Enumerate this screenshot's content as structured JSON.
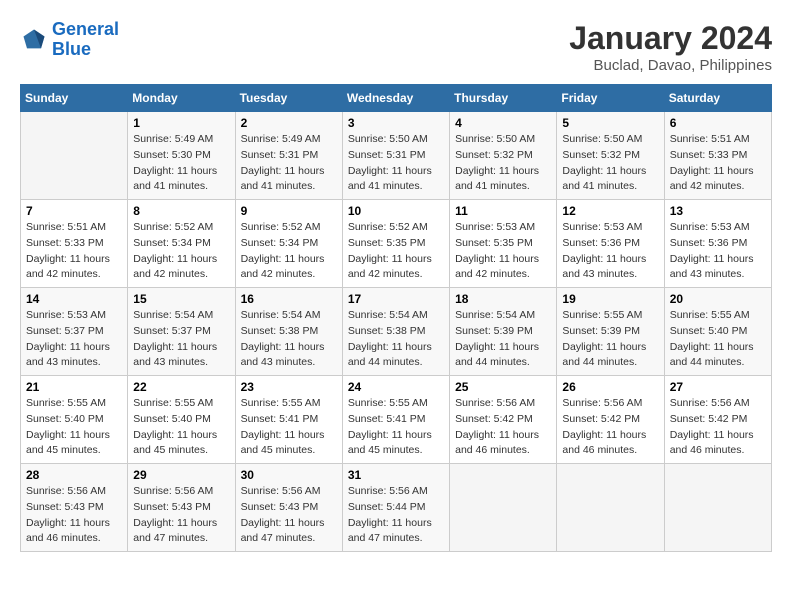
{
  "header": {
    "logo_line1": "General",
    "logo_line2": "Blue",
    "title": "January 2024",
    "subtitle": "Buclad, Davao, Philippines"
  },
  "columns": [
    "Sunday",
    "Monday",
    "Tuesday",
    "Wednesday",
    "Thursday",
    "Friday",
    "Saturday"
  ],
  "weeks": [
    [
      {
        "day": "",
        "info": ""
      },
      {
        "day": "1",
        "info": "Sunrise: 5:49 AM\nSunset: 5:30 PM\nDaylight: 11 hours\nand 41 minutes."
      },
      {
        "day": "2",
        "info": "Sunrise: 5:49 AM\nSunset: 5:31 PM\nDaylight: 11 hours\nand 41 minutes."
      },
      {
        "day": "3",
        "info": "Sunrise: 5:50 AM\nSunset: 5:31 PM\nDaylight: 11 hours\nand 41 minutes."
      },
      {
        "day": "4",
        "info": "Sunrise: 5:50 AM\nSunset: 5:32 PM\nDaylight: 11 hours\nand 41 minutes."
      },
      {
        "day": "5",
        "info": "Sunrise: 5:50 AM\nSunset: 5:32 PM\nDaylight: 11 hours\nand 41 minutes."
      },
      {
        "day": "6",
        "info": "Sunrise: 5:51 AM\nSunset: 5:33 PM\nDaylight: 11 hours\nand 42 minutes."
      }
    ],
    [
      {
        "day": "7",
        "info": "Sunrise: 5:51 AM\nSunset: 5:33 PM\nDaylight: 11 hours\nand 42 minutes."
      },
      {
        "day": "8",
        "info": "Sunrise: 5:52 AM\nSunset: 5:34 PM\nDaylight: 11 hours\nand 42 minutes."
      },
      {
        "day": "9",
        "info": "Sunrise: 5:52 AM\nSunset: 5:34 PM\nDaylight: 11 hours\nand 42 minutes."
      },
      {
        "day": "10",
        "info": "Sunrise: 5:52 AM\nSunset: 5:35 PM\nDaylight: 11 hours\nand 42 minutes."
      },
      {
        "day": "11",
        "info": "Sunrise: 5:53 AM\nSunset: 5:35 PM\nDaylight: 11 hours\nand 42 minutes."
      },
      {
        "day": "12",
        "info": "Sunrise: 5:53 AM\nSunset: 5:36 PM\nDaylight: 11 hours\nand 43 minutes."
      },
      {
        "day": "13",
        "info": "Sunrise: 5:53 AM\nSunset: 5:36 PM\nDaylight: 11 hours\nand 43 minutes."
      }
    ],
    [
      {
        "day": "14",
        "info": "Sunrise: 5:53 AM\nSunset: 5:37 PM\nDaylight: 11 hours\nand 43 minutes."
      },
      {
        "day": "15",
        "info": "Sunrise: 5:54 AM\nSunset: 5:37 PM\nDaylight: 11 hours\nand 43 minutes."
      },
      {
        "day": "16",
        "info": "Sunrise: 5:54 AM\nSunset: 5:38 PM\nDaylight: 11 hours\nand 43 minutes."
      },
      {
        "day": "17",
        "info": "Sunrise: 5:54 AM\nSunset: 5:38 PM\nDaylight: 11 hours\nand 44 minutes."
      },
      {
        "day": "18",
        "info": "Sunrise: 5:54 AM\nSunset: 5:39 PM\nDaylight: 11 hours\nand 44 minutes."
      },
      {
        "day": "19",
        "info": "Sunrise: 5:55 AM\nSunset: 5:39 PM\nDaylight: 11 hours\nand 44 minutes."
      },
      {
        "day": "20",
        "info": "Sunrise: 5:55 AM\nSunset: 5:40 PM\nDaylight: 11 hours\nand 44 minutes."
      }
    ],
    [
      {
        "day": "21",
        "info": "Sunrise: 5:55 AM\nSunset: 5:40 PM\nDaylight: 11 hours\nand 45 minutes."
      },
      {
        "day": "22",
        "info": "Sunrise: 5:55 AM\nSunset: 5:40 PM\nDaylight: 11 hours\nand 45 minutes."
      },
      {
        "day": "23",
        "info": "Sunrise: 5:55 AM\nSunset: 5:41 PM\nDaylight: 11 hours\nand 45 minutes."
      },
      {
        "day": "24",
        "info": "Sunrise: 5:55 AM\nSunset: 5:41 PM\nDaylight: 11 hours\nand 45 minutes."
      },
      {
        "day": "25",
        "info": "Sunrise: 5:56 AM\nSunset: 5:42 PM\nDaylight: 11 hours\nand 46 minutes."
      },
      {
        "day": "26",
        "info": "Sunrise: 5:56 AM\nSunset: 5:42 PM\nDaylight: 11 hours\nand 46 minutes."
      },
      {
        "day": "27",
        "info": "Sunrise: 5:56 AM\nSunset: 5:42 PM\nDaylight: 11 hours\nand 46 minutes."
      }
    ],
    [
      {
        "day": "28",
        "info": "Sunrise: 5:56 AM\nSunset: 5:43 PM\nDaylight: 11 hours\nand 46 minutes."
      },
      {
        "day": "29",
        "info": "Sunrise: 5:56 AM\nSunset: 5:43 PM\nDaylight: 11 hours\nand 47 minutes."
      },
      {
        "day": "30",
        "info": "Sunrise: 5:56 AM\nSunset: 5:43 PM\nDaylight: 11 hours\nand 47 minutes."
      },
      {
        "day": "31",
        "info": "Sunrise: 5:56 AM\nSunset: 5:44 PM\nDaylight: 11 hours\nand 47 minutes."
      },
      {
        "day": "",
        "info": ""
      },
      {
        "day": "",
        "info": ""
      },
      {
        "day": "",
        "info": ""
      }
    ]
  ]
}
